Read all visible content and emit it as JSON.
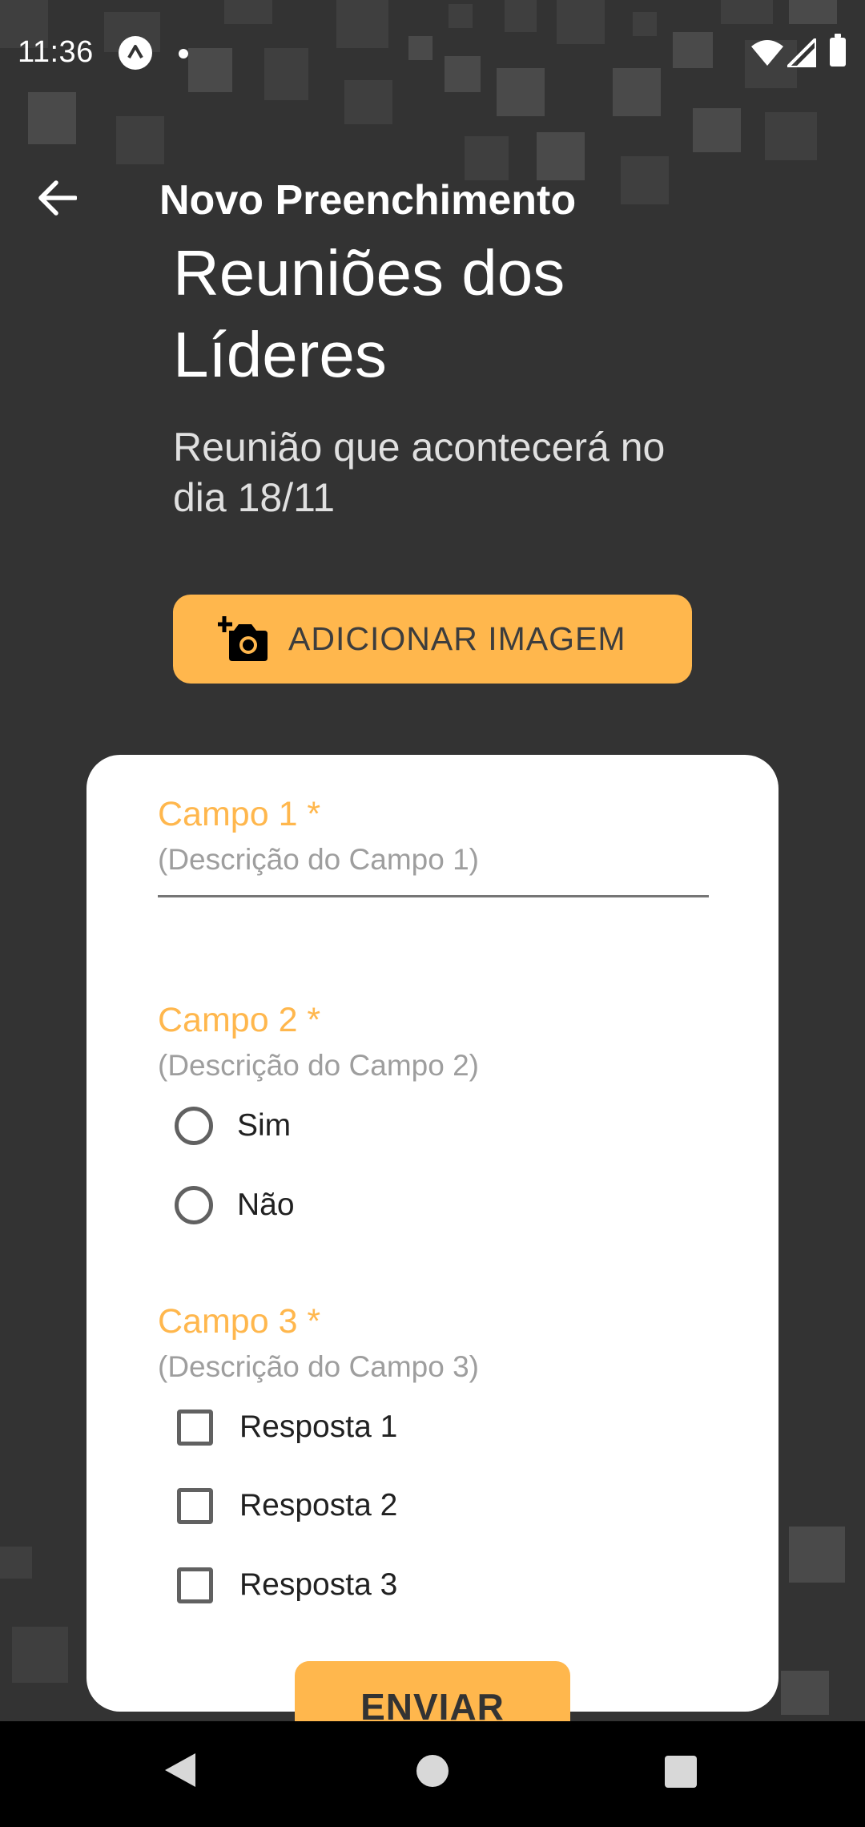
{
  "status_bar": {
    "time": "11:36"
  },
  "app_bar": {
    "title": "Novo Preenchimento"
  },
  "form": {
    "title": "Reuniões dos Líderes",
    "description": "Reunião que acontecerá no dia 18/11",
    "add_image_label": "ADICIONAR IMAGEM"
  },
  "fields": [
    {
      "label": "Campo 1 *",
      "description": "(Descrição do Campo 1)",
      "type": "text",
      "value": ""
    },
    {
      "label": "Campo 2 *",
      "description": "(Descrição do Campo 2)",
      "type": "radio",
      "options": [
        {
          "label": "Sim",
          "selected": false
        },
        {
          "label": "Não",
          "selected": false
        }
      ]
    },
    {
      "label": "Campo 3 *",
      "description": "(Descrição do Campo 3)",
      "type": "checkbox",
      "options": [
        {
          "label": "Resposta 1",
          "checked": false
        },
        {
          "label": "Resposta 2",
          "checked": false
        },
        {
          "label": "Resposta 3",
          "checked": false
        }
      ]
    }
  ],
  "submit_label": "ENVIAR",
  "colors": {
    "accent": "#ffb74d",
    "background": "#333333",
    "card": "#ffffff"
  },
  "icons": {
    "back": "arrow-left-icon",
    "add_photo": "add-a-photo-icon"
  }
}
